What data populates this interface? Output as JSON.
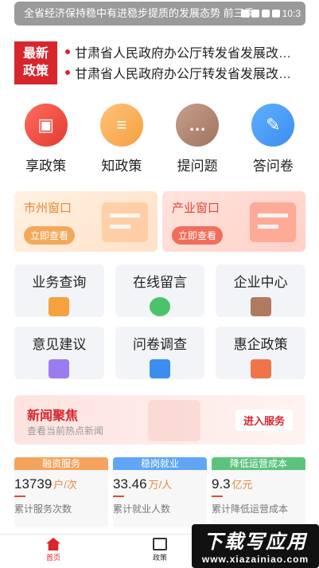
{
  "status": {
    "notification": "全省经济保持稳中有进稳步提质的发展态势 前三季",
    "time": "10:3"
  },
  "ticker": {
    "badge_line1": "最新",
    "badge_line2": "政策",
    "items": [
      "甘肃省人民政府办公厅转发省发展改…",
      "甘肃省人民政府办公厅转发省发展改…"
    ]
  },
  "features": [
    {
      "label": "享政策"
    },
    {
      "label": "知政策"
    },
    {
      "label": "提问题"
    },
    {
      "label": "答问卷"
    }
  ],
  "windows": [
    {
      "title": "市州窗口",
      "button": "立即查看"
    },
    {
      "title": "产业窗口",
      "button": "立即查看"
    }
  ],
  "services": [
    {
      "label": "业务查询"
    },
    {
      "label": "在线留言"
    },
    {
      "label": "企业中心"
    },
    {
      "label": "意见建议"
    },
    {
      "label": "问卷调查"
    },
    {
      "label": "惠企政策"
    }
  ],
  "news": {
    "title": "新闻聚焦",
    "subtitle": "查看当前热点新闻",
    "button": "进入服务"
  },
  "stats": [
    {
      "header": "融资服务",
      "value": "13739",
      "unit": "户/次",
      "desc": "累计服务次数"
    },
    {
      "header": "稳岗就业",
      "value": "33.46",
      "unit": "万/人",
      "desc": "累计就业人数"
    },
    {
      "header": "降低运营成本",
      "value": "9.3",
      "unit": "亿元",
      "desc": "累计降低运营成本"
    }
  ],
  "bottom_nav": [
    {
      "label": "首页"
    },
    {
      "label": "政策"
    }
  ],
  "watermark": {
    "line1": "下载写应用",
    "line2": "www.xiazainiao.com"
  },
  "colors": {
    "brand_red": "#d8262c",
    "accent_orange": "#f4a35c",
    "accent_blue": "#5fa6f4",
    "accent_green": "#5cc37d"
  }
}
